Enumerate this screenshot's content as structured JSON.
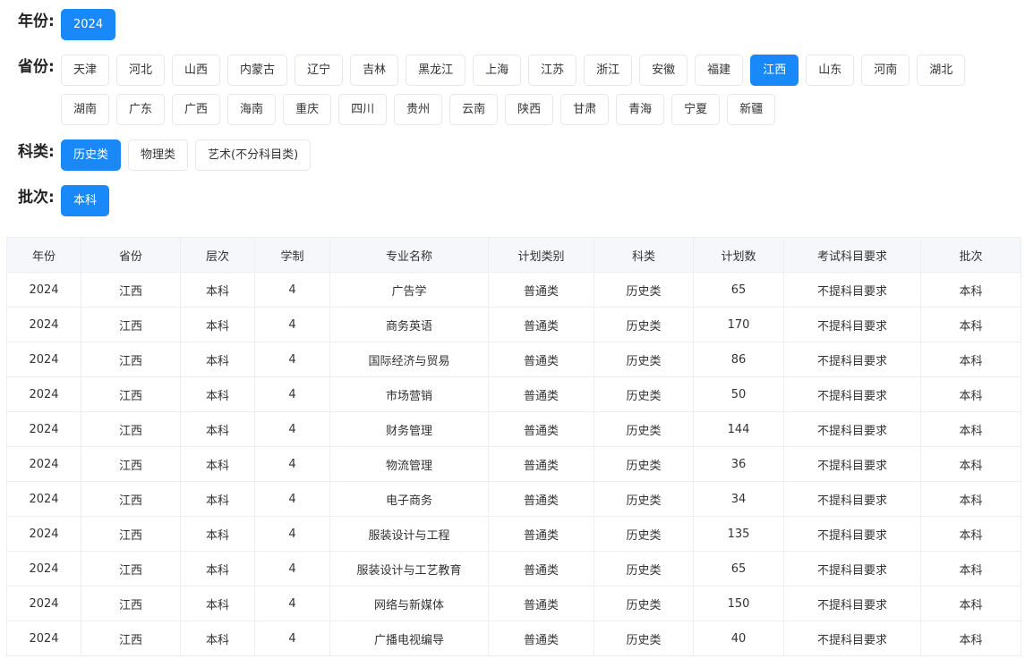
{
  "filters": {
    "year": {
      "label": "年份:",
      "options": [
        "2024"
      ],
      "selected": "2024"
    },
    "province": {
      "label": "省份:",
      "options": [
        "天津",
        "河北",
        "山西",
        "内蒙古",
        "辽宁",
        "吉林",
        "黑龙江",
        "上海",
        "江苏",
        "浙江",
        "安徽",
        "福建",
        "江西",
        "山东",
        "河南",
        "湖北",
        "湖南",
        "广东",
        "广西",
        "海南",
        "重庆",
        "四川",
        "贵州",
        "云南",
        "陕西",
        "甘肃",
        "青海",
        "宁夏",
        "新疆"
      ],
      "selected": "江西"
    },
    "subject": {
      "label": "科类:",
      "options": [
        "历史类",
        "物理类",
        "艺术(不分科目类)"
      ],
      "selected": "历史类"
    },
    "batch": {
      "label": "批次:",
      "options": [
        "本科"
      ],
      "selected": "本科"
    }
  },
  "table": {
    "headers": [
      "年份",
      "省份",
      "层次",
      "学制",
      "专业名称",
      "计划类别",
      "科类",
      "计划数",
      "考试科目要求",
      "批次"
    ],
    "rows": [
      [
        "2024",
        "江西",
        "本科",
        "4",
        "广告学",
        "普通类",
        "历史类",
        "65",
        "不提科目要求",
        "本科"
      ],
      [
        "2024",
        "江西",
        "本科",
        "4",
        "商务英语",
        "普通类",
        "历史类",
        "170",
        "不提科目要求",
        "本科"
      ],
      [
        "2024",
        "江西",
        "本科",
        "4",
        "国际经济与贸易",
        "普通类",
        "历史类",
        "86",
        "不提科目要求",
        "本科"
      ],
      [
        "2024",
        "江西",
        "本科",
        "4",
        "市场营销",
        "普通类",
        "历史类",
        "50",
        "不提科目要求",
        "本科"
      ],
      [
        "2024",
        "江西",
        "本科",
        "4",
        "财务管理",
        "普通类",
        "历史类",
        "144",
        "不提科目要求",
        "本科"
      ],
      [
        "2024",
        "江西",
        "本科",
        "4",
        "物流管理",
        "普通类",
        "历史类",
        "36",
        "不提科目要求",
        "本科"
      ],
      [
        "2024",
        "江西",
        "本科",
        "4",
        "电子商务",
        "普通类",
        "历史类",
        "34",
        "不提科目要求",
        "本科"
      ],
      [
        "2024",
        "江西",
        "本科",
        "4",
        "服装设计与工程",
        "普通类",
        "历史类",
        "135",
        "不提科目要求",
        "本科"
      ],
      [
        "2024",
        "江西",
        "本科",
        "4",
        "服装设计与工艺教育",
        "普通类",
        "历史类",
        "65",
        "不提科目要求",
        "本科"
      ],
      [
        "2024",
        "江西",
        "本科",
        "4",
        "网络与新媒体",
        "普通类",
        "历史类",
        "150",
        "不提科目要求",
        "本科"
      ],
      [
        "2024",
        "江西",
        "本科",
        "4",
        "广播电视编导",
        "普通类",
        "历史类",
        "40",
        "不提科目要求",
        "本科"
      ]
    ]
  },
  "colors": {
    "accent": "#1989fa",
    "border": "#e4e7ed",
    "header_bg": "#f5f7fa"
  }
}
